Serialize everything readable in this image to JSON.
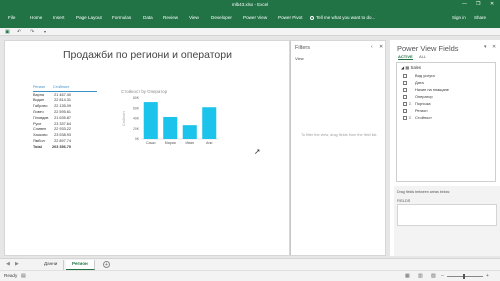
{
  "window": {
    "title": "mlb43.xlsx - Excel",
    "controls": {
      "minimize": "—",
      "restore": "❐",
      "close": "✕"
    }
  },
  "ribbon": {
    "tabs": [
      "File",
      "Home",
      "Insert",
      "Page Layout",
      "Formulas",
      "Data",
      "Review",
      "View",
      "Developer",
      "Power View",
      "Power Pivot"
    ],
    "tell_me": "Tell me what you want to do...",
    "sign_in": "Sign in",
    "share": "Share"
  },
  "report": {
    "title": "Продажби по региони и оператори",
    "table": {
      "headers": [
        "Регион",
        "Стойност"
      ],
      "rows": [
        [
          "Варна",
          "21 467.40"
        ],
        [
          "Видин",
          "22 814.31"
        ],
        [
          "Габрово",
          "22 135.09"
        ],
        [
          "Ловеч",
          "22 595.61"
        ],
        [
          "Пловдив",
          "21 635.87"
        ],
        [
          "Русе",
          "23 337.64"
        ],
        [
          "Сливен",
          "22 933.22"
        ],
        [
          "Хасково",
          "23 538.93"
        ],
        [
          "Ямбол",
          "22 897.74"
        ]
      ],
      "total_label": "Total",
      "total_value": "203 356.70"
    }
  },
  "chart_data": {
    "type": "bar",
    "title": "Стойност by Оператор",
    "categories": [
      "Сашо",
      "Мария",
      "Иван",
      "Ани"
    ],
    "values": [
      72000,
      43000,
      27000,
      62000
    ],
    "ytick_labels": [
      "0K",
      "20K",
      "40K",
      "60K",
      "80K"
    ],
    "ylim": [
      0,
      80000
    ],
    "ylabel": "Стойност",
    "xlabel": "",
    "grid": false,
    "color": "#1cc3ea"
  },
  "filters": {
    "title": "Filters",
    "view_tab": "View",
    "hint": "To filter the view, drag fields from the field list."
  },
  "fields_pane": {
    "title": "Power View Fields",
    "tab_active": "ACTIVE",
    "tab_all": "ALL",
    "table_name": "Sales",
    "fields": [
      {
        "label": "Вид услуга",
        "sigma": false
      },
      {
        "label": "Дата",
        "sigma": false
      },
      {
        "label": "Начин на плащане",
        "sigma": false
      },
      {
        "label": "Оператор",
        "sigma": false
      },
      {
        "label": "Поръчка",
        "sigma": true
      },
      {
        "label": "Регион",
        "sigma": false
      },
      {
        "label": "Стойност",
        "sigma": true
      }
    ],
    "drag_text": "Drag fields between areas below:",
    "areas_label": "FIELDS"
  },
  "sheets": {
    "tabs": [
      "Данни",
      "Регион"
    ],
    "active": "Регион"
  },
  "status": {
    "ready": "Ready"
  },
  "colors": {
    "excel_green": "#217346",
    "bar": "#1cc3ea"
  }
}
